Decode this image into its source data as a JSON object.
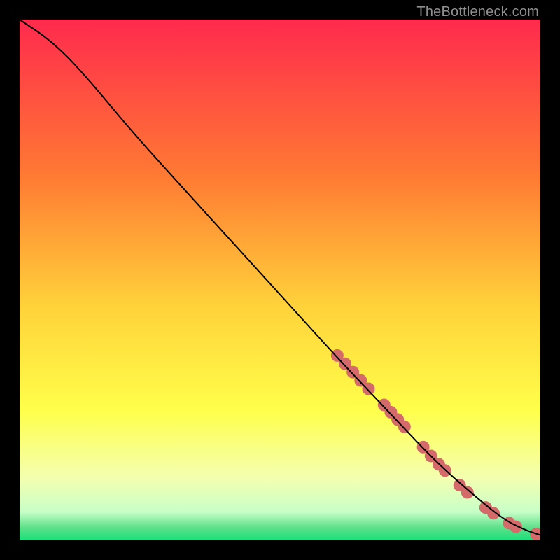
{
  "watermark": "TheBottleneck.com",
  "chart_data": {
    "type": "line",
    "title": "",
    "xlabel": "",
    "ylabel": "",
    "xlim": [
      0,
      100
    ],
    "ylim": [
      0,
      100
    ],
    "grid": false,
    "legend": false,
    "background_gradient_stops": [
      {
        "offset": 0.0,
        "color": "#ff2a4d"
      },
      {
        "offset": 0.3,
        "color": "#ff7a33"
      },
      {
        "offset": 0.55,
        "color": "#ffd23a"
      },
      {
        "offset": 0.75,
        "color": "#ffff4a"
      },
      {
        "offset": 0.88,
        "color": "#f4ffb0"
      },
      {
        "offset": 0.945,
        "color": "#c8ffc8"
      },
      {
        "offset": 0.975,
        "color": "#5fe08a"
      },
      {
        "offset": 1.0,
        "color": "#19e07a"
      }
    ],
    "series": [
      {
        "name": "curve",
        "stroke": "#000000",
        "stroke_width": 2,
        "points_xy": [
          [
            0,
            100
          ],
          [
            6,
            96
          ],
          [
            12,
            90
          ],
          [
            22,
            78
          ],
          [
            32,
            67
          ],
          [
            42,
            56
          ],
          [
            52,
            45
          ],
          [
            62,
            34
          ],
          [
            72,
            23.5
          ],
          [
            80,
            15
          ],
          [
            88,
            8
          ],
          [
            93,
            4
          ],
          [
            97,
            2
          ],
          [
            100,
            1
          ]
        ]
      }
    ],
    "markers": {
      "color": "#d46a6a",
      "radius": 9,
      "points_xy": [
        [
          61,
          35.5
        ],
        [
          62.5,
          33.9
        ],
        [
          64,
          32.3
        ],
        [
          65.5,
          30.7
        ],
        [
          67,
          29.1
        ],
        [
          70,
          26
        ],
        [
          71.3,
          24.6
        ],
        [
          72.6,
          23.2
        ],
        [
          73.9,
          21.8
        ],
        [
          77.5,
          17.9
        ],
        [
          79,
          16.2
        ],
        [
          80.5,
          14.6
        ],
        [
          81.7,
          13.4
        ],
        [
          84.5,
          10.6
        ],
        [
          86,
          9.2
        ],
        [
          89.5,
          6.3
        ],
        [
          91,
          5.2
        ],
        [
          94,
          3.3
        ],
        [
          95.3,
          2.6
        ],
        [
          99.2,
          1.2
        ],
        [
          101.2,
          1.0
        ]
      ]
    }
  }
}
